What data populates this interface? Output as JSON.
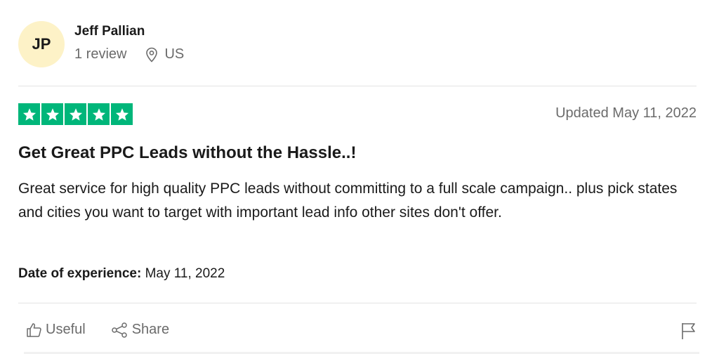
{
  "reviewer": {
    "initials": "JP",
    "name": "Jeff Pallian",
    "review_count": "1 review",
    "location": "US",
    "avatar_color": "#fdf2c7"
  },
  "review": {
    "rating": 5,
    "max_rating": 5,
    "star_color": "#00b67a",
    "updated": "Updated May 11, 2022",
    "title": "Get Great PPC Leads without the Hassle..!",
    "body": "Great service for high quality PPC leads without committing to a full scale campaign.. plus pick states and cities you want to target with important lead info other sites don't offer.",
    "date_of_experience_label": "Date of experience:",
    "date_of_experience_value": "May 11, 2022"
  },
  "actions": {
    "useful_label": "Useful",
    "share_label": "Share"
  },
  "icons": {
    "location": "location-pin-icon",
    "useful": "thumbs-up-icon",
    "share": "share-icon",
    "flag": "flag-icon",
    "star": "star-icon"
  }
}
